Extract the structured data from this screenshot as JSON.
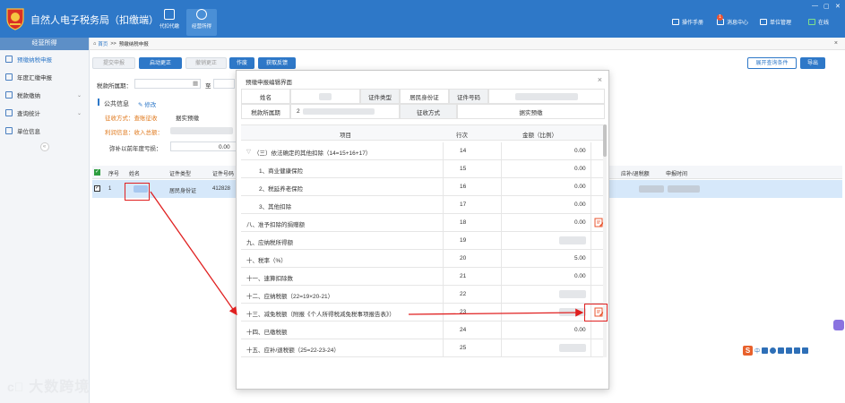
{
  "header": {
    "app_title": "自然人电子税务局（扣缴端）",
    "nav": [
      {
        "label": "代扣代缴"
      },
      {
        "label": "经营所得"
      }
    ],
    "right": [
      {
        "label": "操作手册"
      },
      {
        "label": "消息中心",
        "badge": "1"
      },
      {
        "label": "单位管理"
      },
      {
        "label": "在线"
      }
    ]
  },
  "sidebar": {
    "title": "经营所得",
    "items": [
      {
        "label": "预缴纳税申报"
      },
      {
        "label": "年度汇缴申报"
      },
      {
        "label": "税款缴纳"
      },
      {
        "label": "查询统计"
      },
      {
        "label": "单位信息"
      }
    ],
    "collapse_glyph": "«"
  },
  "tabbar": {
    "home": "首页",
    "sep": ">>",
    "current": "预缴纳税申报",
    "close": "×"
  },
  "toolbar": {
    "submit": "提交申报",
    "start_correct": "启动更正",
    "cancel_correct": "撤销更正",
    "void": "作废",
    "feedback": "获取反馈",
    "expand": "展开查询条件",
    "export": "导出"
  },
  "filters": {
    "period_label": "税款所属期：",
    "to": "至"
  },
  "public_info": {
    "title": "公共信息",
    "edit": "修改",
    "collect_label": "征收方式：查账征收",
    "collect_value": "据实预缴",
    "profit_label": "利润信息：收入总额：",
    "loss_label": "弥补以前年度亏损：",
    "loss_value": "0.00"
  },
  "table": {
    "headers": [
      "序号",
      "姓名",
      "证件类型",
      "证件号码",
      "应补/退税额",
      "申报时间"
    ],
    "row": {
      "index": "1",
      "id_type": "居民身份证",
      "id_prefix": "412828"
    }
  },
  "dialog": {
    "title": "预缴申报编辑界面",
    "close": "×",
    "info": {
      "name_label": "姓名",
      "id_type_label": "证件类型",
      "id_type_value": "居民身份证",
      "id_no_label": "证件号码",
      "period_label": "税款所属期",
      "period_prefix": "2",
      "method_label": "征收方式",
      "method_value": "据实预缴"
    },
    "columns": [
      "项目",
      "行次",
      "金额（比例）"
    ],
    "rows": [
      {
        "item": "（三）依法确定的其他扣除（14=15+16+17）",
        "line": "14",
        "amount": "0.00",
        "collapse": "▽"
      },
      {
        "item": "1、商业健康保险",
        "line": "15",
        "amount": "0.00"
      },
      {
        "item": "2、税延养老保险",
        "line": "16",
        "amount": "0.00"
      },
      {
        "item": "3、其他扣除",
        "line": "17",
        "amount": "0.00"
      },
      {
        "item": "八、准予扣除的捐赠额",
        "line": "18",
        "amount": "0.00",
        "edit": true
      },
      {
        "item": "九、应纳税所得额",
        "line": "19",
        "amount": ""
      },
      {
        "item": "十、税率（%）",
        "line": "20",
        "amount": "5.00"
      },
      {
        "item": "十一、速算扣除数",
        "line": "21",
        "amount": "0.00"
      },
      {
        "item": "十二、应纳税额（22=19×20-21）",
        "line": "22",
        "amount": ""
      },
      {
        "item": "十三、减免税额（附报《个人所得税减免税事项报告表》）",
        "line": "23",
        "amount": "",
        "edit": true
      },
      {
        "item": "十四、已缴税额",
        "line": "24",
        "amount": "0.00"
      },
      {
        "item": "十五、应补/退税额（25=22-23-24）",
        "line": "25",
        "amount": ""
      }
    ]
  },
  "watermark": "大数跨境",
  "colors": {
    "primary": "#2e78c8",
    "highlight": "#e02020",
    "edit_icon": "#e8532c",
    "row_selected": "#d6e8fa"
  }
}
